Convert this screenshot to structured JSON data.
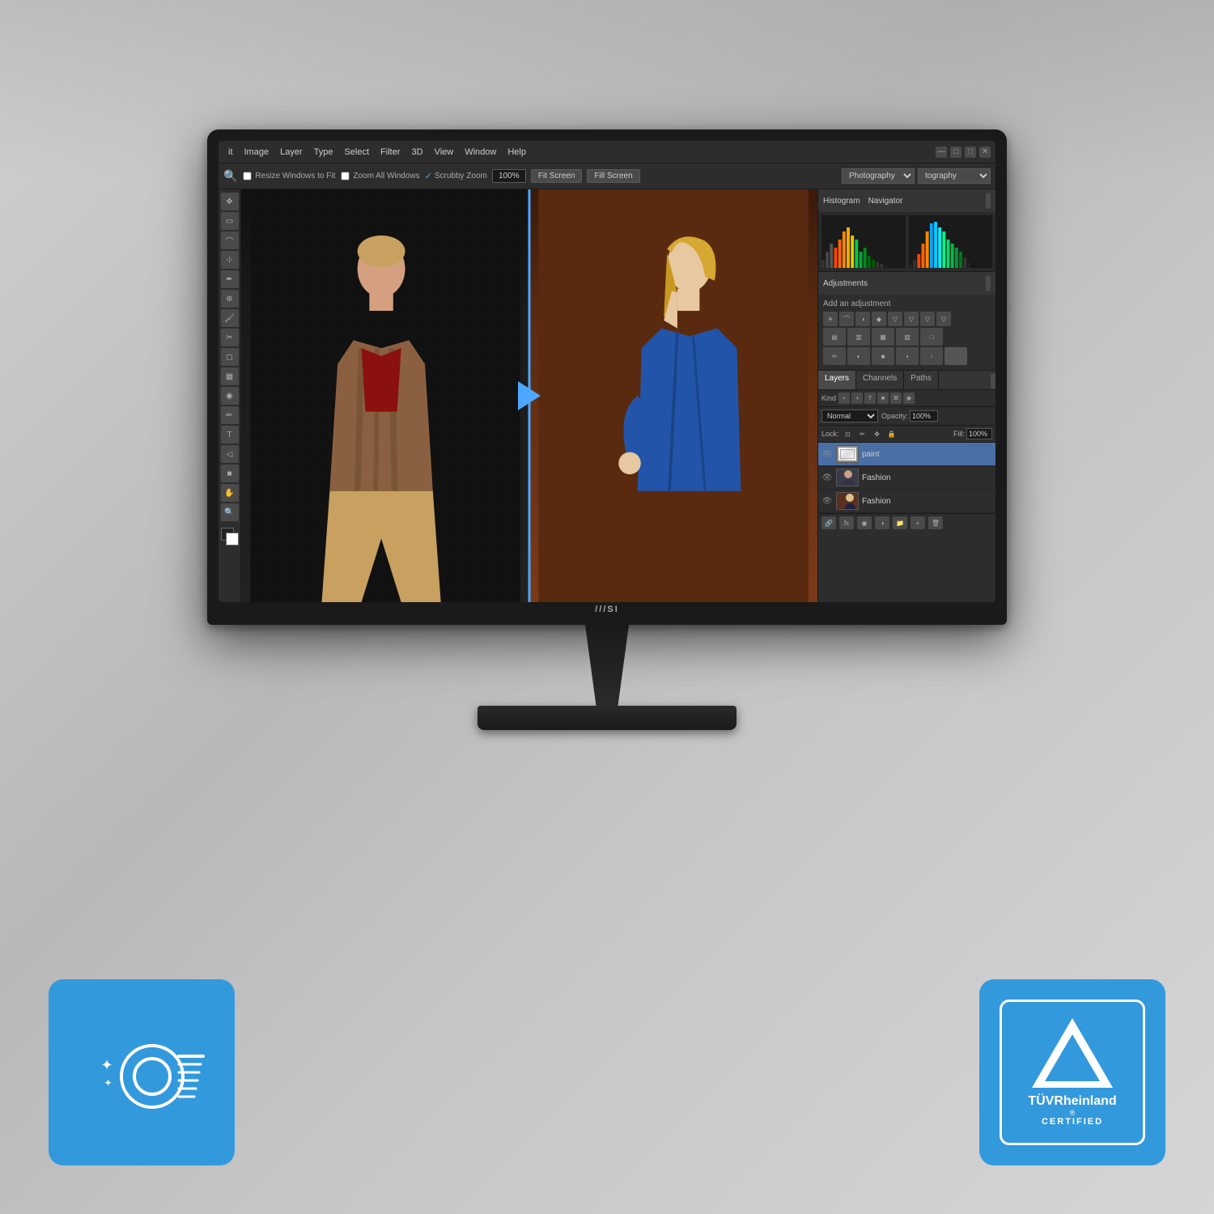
{
  "background": {
    "color": "#c8c8c8"
  },
  "monitor": {
    "brand": "///SI",
    "screen": {
      "photoshop": {
        "menubar": {
          "items": [
            "it",
            "Image",
            "Layer",
            "Type",
            "Select",
            "Filter",
            "3D",
            "View",
            "Window",
            "Help"
          ]
        },
        "toolbar": {
          "resize_windows_label": "Resize Windows to Fit",
          "zoom_all_windows_label": "Zoom All Windows",
          "scrubby_zoom_label": "Scrubby Zoom",
          "zoom_percent": "100%",
          "fit_screen_label": "Fit Screen",
          "fill_screen_label": "Fill Screen",
          "workspace_dropdown1": "Photography",
          "workspace_dropdown2": "tography"
        },
        "right_panel": {
          "histogram_label": "Histogram",
          "navigator_label": "Navigator",
          "adjustments_label": "Adjustments",
          "add_adjustment_label": "Add an adjustment",
          "layers_label": "Layers",
          "channels_label": "Channels",
          "paths_label": "Paths",
          "kind_label": "Kind",
          "normal_label": "Normal",
          "opacity_label": "Opacity",
          "opacity_value": "100%",
          "lock_label": "Lock:",
          "fill_label": "Fill:",
          "fill_value": "100%",
          "layers": [
            {
              "name": "paint",
              "type": "active",
              "thumb": "white"
            },
            {
              "name": "Fashion",
              "type": "image",
              "thumb": "photo"
            },
            {
              "name": "Fashion",
              "type": "image",
              "thumb": "photo"
            }
          ]
        }
      }
    }
  },
  "badges": {
    "eyecare": {
      "label": "Eye Care"
    },
    "tuv": {
      "line1": "TÜVRheinland",
      "line2": "®",
      "line3": "CERTIFIED"
    }
  }
}
